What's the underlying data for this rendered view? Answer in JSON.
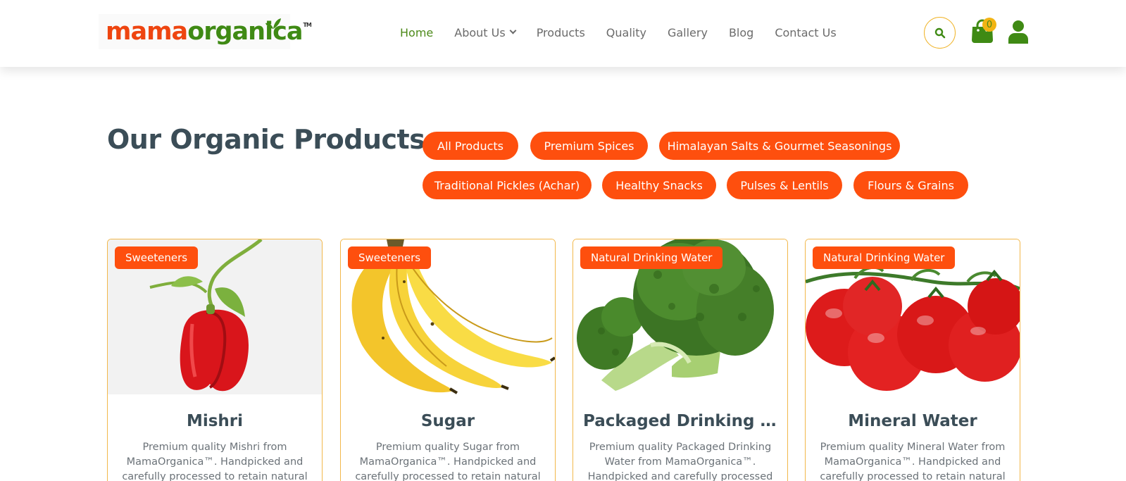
{
  "brand": {
    "logo_part1": "mama",
    "logo_part2": "organica",
    "logo_tm": "TM"
  },
  "nav": {
    "items": [
      {
        "label": "Home",
        "active": true
      },
      {
        "label": "About Us",
        "has_dropdown": true
      },
      {
        "label": "Products"
      },
      {
        "label": "Quality"
      },
      {
        "label": "Gallery"
      },
      {
        "label": "Blog"
      },
      {
        "label": "Contact Us"
      }
    ]
  },
  "header_actions": {
    "search_icon": "search-icon",
    "cart_icon": "shopping-bag-icon",
    "cart_count": "0",
    "user_icon": "user-icon"
  },
  "section": {
    "title": "Our Organic Products",
    "filters": [
      "All Products",
      "Premium Spices",
      "Himalayan Salts & Gourmet Seasonings",
      "Traditional Pickles (Achar)",
      "Healthy Snacks",
      "Pulses & Lentils",
      "Flours & Grains"
    ]
  },
  "products": [
    {
      "tag": "Sweeteners",
      "title": "Mishri",
      "description": "Premium quality Mishri from MamaOrganica™. Handpicked and carefully processed to retain natural",
      "image": "red-bell-pepper"
    },
    {
      "tag": "Sweeteners",
      "title": "Sugar",
      "description": "Premium quality Sugar from MamaOrganica™. Handpicked and carefully processed to retain natural",
      "image": "bananas"
    },
    {
      "tag": "Natural Drinking Water",
      "title": "Packaged Drinking W...",
      "description": "Premium quality Packaged Drinking Water from MamaOrganica™. Handpicked and carefully processed",
      "image": "broccoli"
    },
    {
      "tag": "Natural Drinking Water",
      "title": "Mineral Water",
      "description": "Premium quality Mineral Water from MamaOrganica™. Handpicked and carefully processed to retain natural",
      "image": "tomatoes-on-vine"
    }
  ],
  "colors": {
    "accent": "#fe4f0e",
    "brand_green": "#4d8a1a",
    "card_border": "#f2b84b",
    "heading": "#3b4d57"
  }
}
